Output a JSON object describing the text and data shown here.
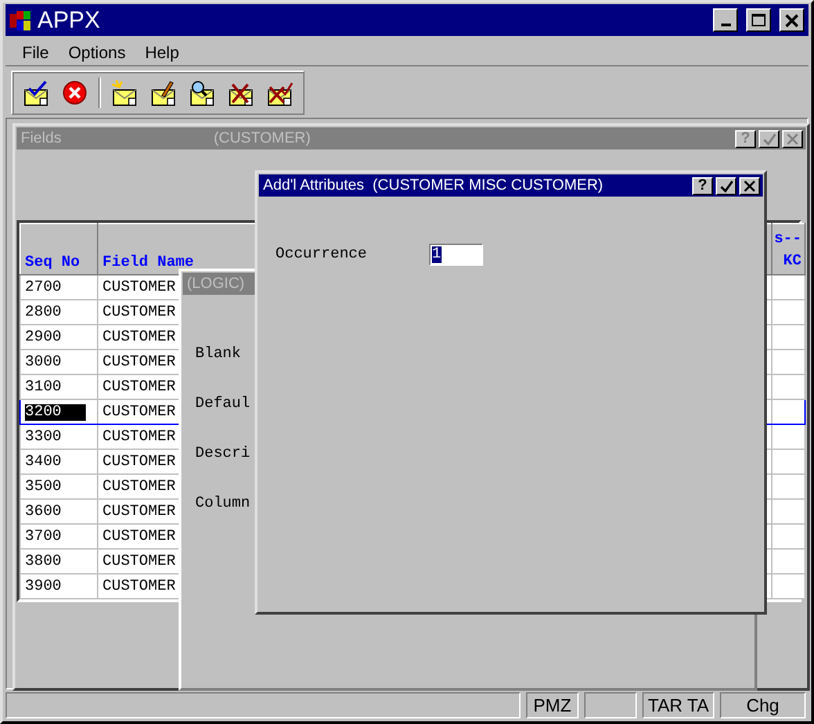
{
  "window": {
    "title": "APPX",
    "menu": [
      {
        "label": "File"
      },
      {
        "label": "Options"
      },
      {
        "label": "Help"
      }
    ]
  },
  "fields_window": {
    "title": "Fields",
    "subtitle": "(CUSTOMER)",
    "help": "?",
    "columns": [
      {
        "lines": [
          "Seq No"
        ]
      },
      {
        "lines": [
          "Field Name"
        ]
      },
      {
        "lines": [
          "s--",
          "KC"
        ]
      }
    ],
    "rows": [
      {
        "seq": "2700",
        "field_name": "CUSTOMER",
        "selected": false
      },
      {
        "seq": "2800",
        "field_name": "CUSTOMER",
        "selected": false
      },
      {
        "seq": "2900",
        "field_name": "CUSTOMER",
        "selected": false
      },
      {
        "seq": "3000",
        "field_name": "CUSTOMER",
        "selected": false
      },
      {
        "seq": "3100",
        "field_name": "CUSTOMER",
        "selected": false
      },
      {
        "seq": "3200",
        "field_name": "CUSTOMER",
        "selected": true
      },
      {
        "seq": "3300",
        "field_name": "CUSTOMER",
        "selected": false
      },
      {
        "seq": "3400",
        "field_name": "CUSTOMER",
        "selected": false
      },
      {
        "seq": "3500",
        "field_name": "CUSTOMER",
        "selected": false
      },
      {
        "seq": "3600",
        "field_name": "CUSTOMER",
        "selected": false
      },
      {
        "seq": "3700",
        "field_name": "CUSTOMER",
        "selected": false
      },
      {
        "seq": "3800",
        "field_name": "CUSTOMER",
        "selected": false
      },
      {
        "seq": "3900",
        "field_name": "CUSTOMER",
        "selected": false
      }
    ]
  },
  "logic_window": {
    "title": "(LOGIC)",
    "labels": [
      "Blank",
      "Defaul",
      "Descri",
      "Column"
    ]
  },
  "dialog": {
    "title": "Add'l Attributes  (CUSTOMER MISC CUSTOMER)",
    "help": "?",
    "fields": [
      {
        "label": "Occurrence",
        "value": "1"
      }
    ]
  },
  "status_bar": [
    {
      "kind": "blank"
    },
    {
      "kind": "text",
      "text": "PMZ"
    },
    {
      "kind": "blank"
    },
    {
      "kind": "text",
      "text": "TAR TA"
    },
    {
      "kind": "text",
      "text": "Chg"
    }
  ]
}
